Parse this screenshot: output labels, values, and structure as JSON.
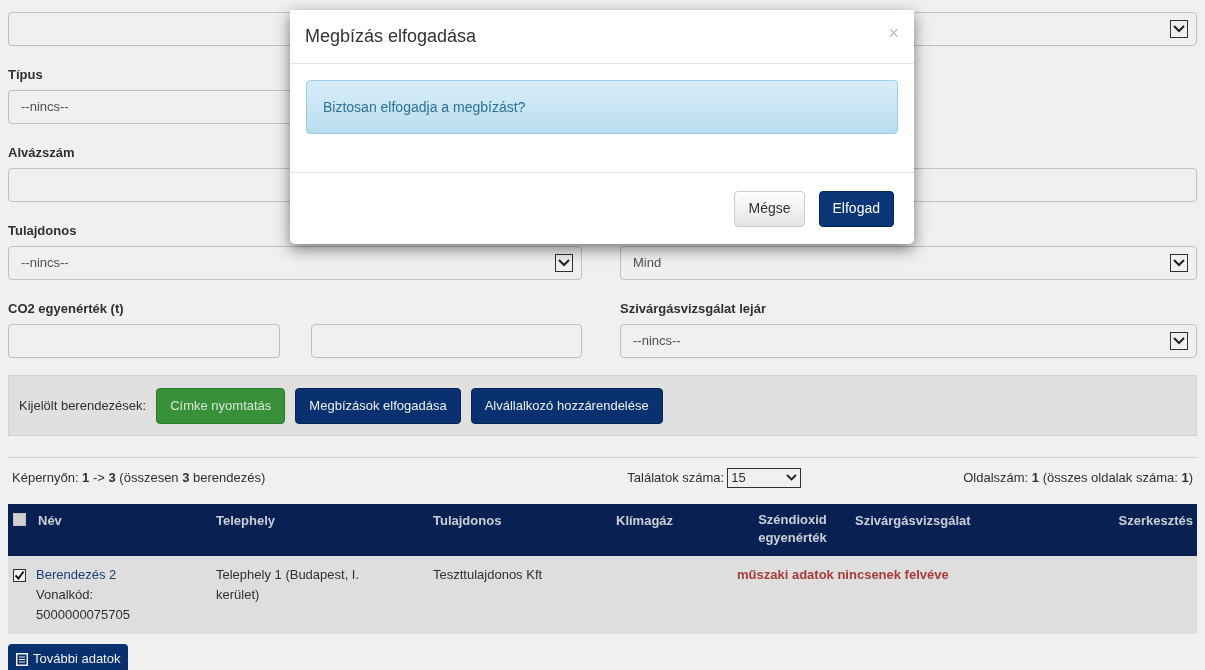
{
  "filters": {
    "tipus": {
      "label": "Típus",
      "value": "--nincs--"
    },
    "alvazszam": {
      "label": "Alvázszám"
    },
    "tulajdonos": {
      "label": "Tulajdonos",
      "value": "--nincs--"
    },
    "right_select_2": {
      "value": "Mind"
    },
    "co2": {
      "label": "CO2 egyenérték (t)"
    },
    "szivargas": {
      "label": "Szivárgásvizsgálat lejár",
      "value": "--nincs--"
    }
  },
  "actions": {
    "label": "Kijelölt berendezések:",
    "buttons": [
      {
        "label": "Címke nyomtatás",
        "kind": "success"
      },
      {
        "label": "Megbízások elfogadása",
        "kind": "primary"
      },
      {
        "label": "Alvállalkozó hozzárendelése",
        "kind": "primary"
      }
    ]
  },
  "results": {
    "summary": "Képernyőn: **1** -> **3** (összesen **3** berendezés)",
    "per_page_label": "Találatok száma:",
    "per_page": "15",
    "pages": "Oldalszám: **1** (összes oldalak száma: **1**)"
  },
  "table": {
    "select_all": {
      "checked": false
    },
    "columns": [
      "Név",
      "Telephely",
      "Tulajdonos",
      "Klímagáz",
      "Széndioxid egyenérték",
      "Szivárgásvizsgálat",
      "Szerkesztés"
    ],
    "rows": [
      {
        "checked": true,
        "name": "Berendezés 2",
        "barcode_label": "Vonalkód:",
        "barcode": "5000000075705",
        "site": "Telephely 1 (Budapest, I. kerület)",
        "owner": "Teszttulajdonos Kft",
        "warning": "műszaki adatok nincsenek felvéve"
      }
    ]
  },
  "more_button": "További adatok",
  "modal": {
    "title": "Megbízás elfogadása",
    "close": "×",
    "message": "Biztosan elfogadja a megbízást?",
    "buttons": [
      {
        "label": "Mégse",
        "kind": "default"
      },
      {
        "label": "Elfogad",
        "kind": "primary"
      }
    ]
  }
}
